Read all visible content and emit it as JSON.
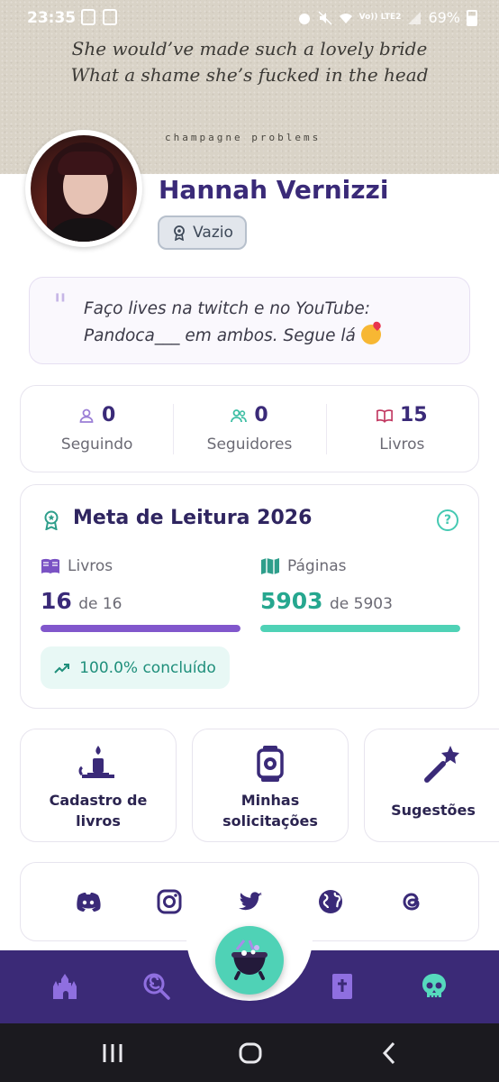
{
  "status_bar": {
    "time": "23:35",
    "battery": "69%",
    "network": "Vo)) LTE2"
  },
  "banner": {
    "lyric_line1": "She would’ve made such a lovely bride",
    "lyric_line2": "What a shame she’s fucked in the head",
    "caption": "champagne problems"
  },
  "profile": {
    "name": "Hannah Vernizzi",
    "badge": "Vazio",
    "bio": "Faço lives na twitch e no YouTube: Pandoca___ em ambos. Segue lá"
  },
  "stats": [
    {
      "value": "0",
      "label": "Seguindo",
      "icon": "user-icon"
    },
    {
      "value": "0",
      "label": "Seguidores",
      "icon": "users-icon"
    },
    {
      "value": "15",
      "label": "Livros",
      "icon": "book-open-icon"
    }
  ],
  "goal": {
    "title": "Meta de Leitura 2026",
    "books": {
      "label": "Livros",
      "value": "16",
      "of": "de 16",
      "progress": 1.0
    },
    "pages": {
      "label": "Páginas",
      "value": "5903",
      "of": "de 5903",
      "progress": 1.0
    },
    "completed": "100.0% concluído"
  },
  "actions": [
    {
      "label": "Cadastro de livros",
      "icon": "candle-icon"
    },
    {
      "label": "Minhas solicitações",
      "icon": "lantern-icon"
    },
    {
      "label": "Sugestões",
      "icon": "magic-wand-icon"
    }
  ],
  "social": [
    "discord-icon",
    "instagram-icon",
    "twitter-icon",
    "globe-icon",
    "threads-icon"
  ],
  "bottom_nav": [
    "castle-icon",
    "lollipop-icon",
    "cauldron-icon",
    "bible-icon",
    "skull-icon"
  ],
  "colors": {
    "primary": "#3b2a77",
    "accent": "#4fd2b6",
    "purple_bar": "#8157cc"
  }
}
